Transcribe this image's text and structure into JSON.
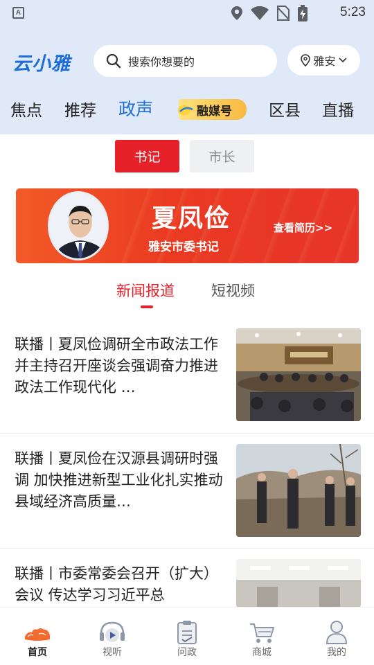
{
  "status_bar": {
    "time": "5:23",
    "notification_letter": "A"
  },
  "header": {
    "logo": "云小雅",
    "search_placeholder": "搜索你想要的",
    "location": "雅安"
  },
  "channel_tabs": [
    {
      "label": "焦点",
      "active": false
    },
    {
      "label": "推荐",
      "active": false
    },
    {
      "label": "政声",
      "active": true
    },
    {
      "label": "融媒号",
      "active": false
    },
    {
      "label": "区县",
      "active": false
    },
    {
      "label": "直播",
      "active": false
    }
  ],
  "segments": [
    {
      "label": "书记",
      "active": true
    },
    {
      "label": "市长",
      "active": false
    }
  ],
  "banner": {
    "name": "夏凤俭",
    "title": "雅安市委书记",
    "link": "查看简历>>"
  },
  "sub_tabs": [
    {
      "label": "新闻报道",
      "active": true
    },
    {
      "label": "短视频",
      "active": false
    }
  ],
  "news": [
    {
      "title": "联播丨夏凤俭调研全市政法工作并主持召开座谈会强调奋力推进政法工作现代化 …",
      "thumb": "meeting"
    },
    {
      "title": "联播丨夏凤俭在汉源县调研时强调 加快推进新型工业化扎实推动县域经济高质量…",
      "thumb": "outdoor"
    },
    {
      "title": "联播丨市委常委会召开（扩大）会议 传达学习习近平总",
      "thumb": "hall"
    }
  ],
  "bottom_nav": [
    {
      "label": "首页",
      "icon": "home-flame-icon",
      "active": true
    },
    {
      "label": "视听",
      "icon": "play-icon",
      "active": false
    },
    {
      "label": "问政",
      "icon": "clipboard-icon",
      "active": false
    },
    {
      "label": "商城",
      "icon": "cart-icon",
      "active": false
    },
    {
      "label": "我的",
      "icon": "user-icon",
      "active": false
    }
  ],
  "colors": {
    "header_bg": "#dfe9f8",
    "brand_blue": "#1f6ed8",
    "accent_red": "#e6212a"
  }
}
